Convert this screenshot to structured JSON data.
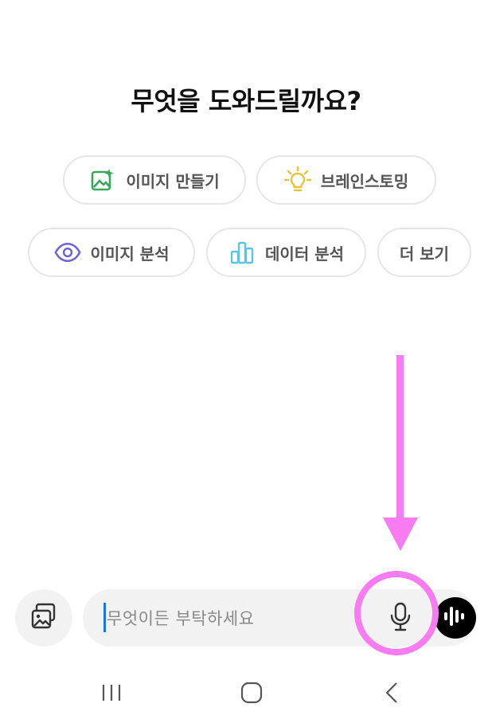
{
  "heading": "무엇을 도와드릴까요?",
  "chips": [
    {
      "label": "이미지 만들기",
      "icon": "image-create-icon",
      "color": "#3ba55c"
    },
    {
      "label": "브레인스토밍",
      "icon": "lightbulb-icon",
      "color": "#e8c23a"
    },
    {
      "label": "이미지 분석",
      "icon": "eye-icon",
      "color": "#6c63d6"
    },
    {
      "label": "데이터 분석",
      "icon": "bar-chart-icon",
      "color": "#5bc3e6"
    },
    {
      "label": "더 보기",
      "icon": "",
      "color": ""
    }
  ],
  "input": {
    "placeholder": "무엇이든 부탁하세요"
  },
  "annotation": {
    "color": "#f77cf2"
  },
  "navbar": {
    "icons": [
      "recent-apps-icon",
      "home-icon",
      "back-icon"
    ]
  }
}
